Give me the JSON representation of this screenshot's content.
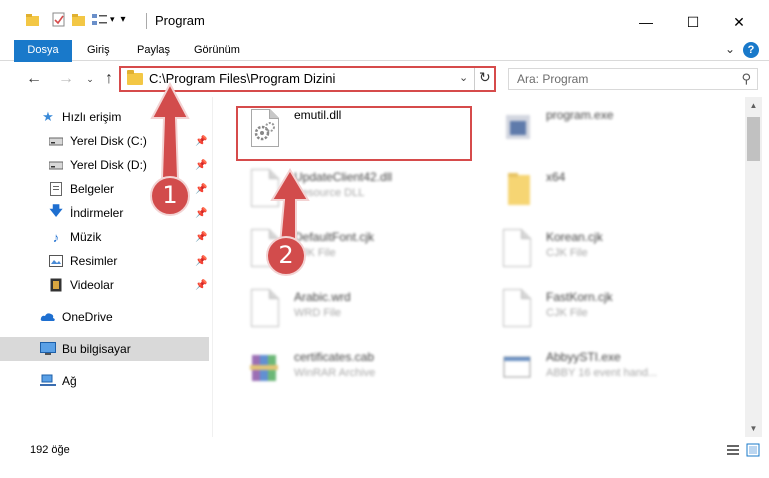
{
  "window": {
    "title": "Program",
    "minimize_glyph": "—",
    "maximize_glyph": "☐",
    "close_glyph": "✕"
  },
  "ribbon": {
    "tabs": [
      "Dosya",
      "Giriş",
      "Paylaş",
      "Görünüm"
    ],
    "help_label": "?"
  },
  "nav": {
    "address": "C:\\Program Files\\Program Dizini",
    "search_placeholder": "Ara: Program"
  },
  "sidebar": {
    "items": [
      {
        "label": "Hızlı erişim",
        "icon": "star-icon"
      },
      {
        "label": "Yerel Disk (C:)",
        "icon": "drive-icon"
      },
      {
        "label": "Yerel Disk (D:)",
        "icon": "drive-icon"
      },
      {
        "label": "Belgeler",
        "icon": "documents-icon"
      },
      {
        "label": "İndirmeler",
        "icon": "download-arrow-icon"
      },
      {
        "label": "Müzik",
        "icon": "music-note-icon"
      },
      {
        "label": "Resimler",
        "icon": "pictures-icon"
      },
      {
        "label": "Videolar",
        "icon": "film-icon"
      },
      {
        "label": "OneDrive",
        "icon": "cloud-icon"
      },
      {
        "label": "Bu bilgisayar",
        "icon": "computer-icon"
      },
      {
        "label": "Ağ",
        "icon": "network-icon"
      }
    ]
  },
  "files": [
    {
      "name": "emutil.dll",
      "type": ""
    },
    {
      "name": "program.exe",
      "type": ""
    },
    {
      "name": "UpdateClient42.dll",
      "type": "Resource DLL"
    },
    {
      "name": "x64",
      "type": ""
    },
    {
      "name": "DefaultFont.cjk",
      "type": "CJK File"
    },
    {
      "name": "Korean.cjk",
      "type": "CJK File"
    },
    {
      "name": "Arabic.wrd",
      "type": "WRD File"
    },
    {
      "name": "FastKorn.cjk",
      "type": "CJK File"
    },
    {
      "name": "certificates.cab",
      "type": "WinRAR Archive"
    },
    {
      "name": "AbbyySTI.exe",
      "type": "ABBY 16 event hand..."
    }
  ],
  "status": {
    "item_count": "192 öğe"
  },
  "annotations": {
    "step1": "1",
    "step2": "2"
  },
  "colors": {
    "accent": "#1979ca",
    "annotation_red": "#d24c4c",
    "folder_yellow": "#f3c745"
  }
}
